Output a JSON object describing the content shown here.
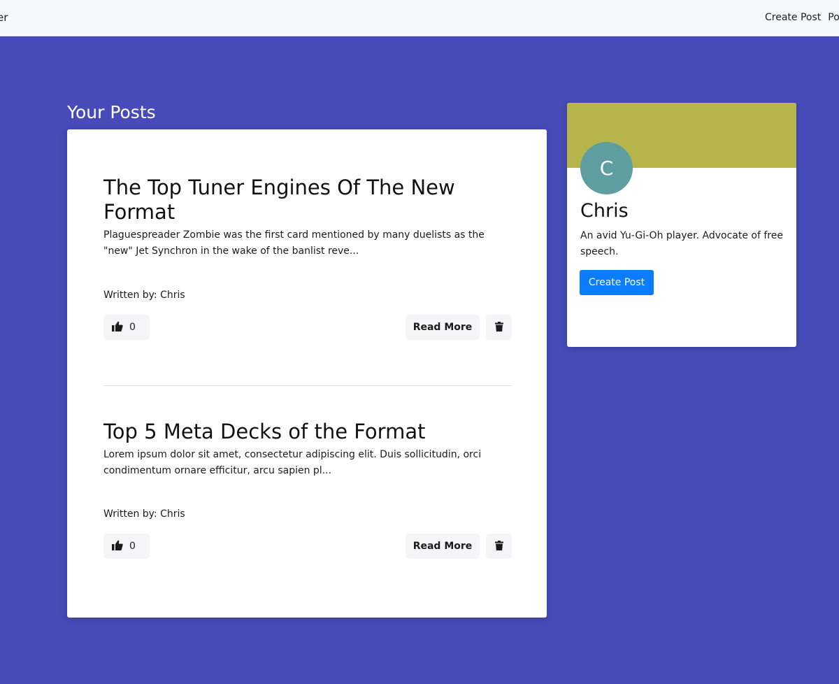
{
  "navbar": {
    "brand": "er",
    "links": [
      "Create Post",
      "Po"
    ]
  },
  "posts_section": {
    "heading": "Your Posts",
    "posts": [
      {
        "title": "The Top Tuner Engines Of The New Format",
        "excerpt": "Plaguespreader Zombie was the first card mentioned by many duelists as the \"new\" Jet Synchron in the wake of the banlist reve...",
        "author": "Written by: Chris",
        "likes": "0",
        "read_more_label": "Read More"
      },
      {
        "title": "Top 5 Meta Decks of the Format",
        "excerpt": "Lorem ipsum dolor sit amet, consectetur adipiscing elit. Duis sollicitudin, orci condimentum ornare efficitur, arcu sapien pl...",
        "author": "Written by: Chris",
        "likes": "0",
        "read_more_label": "Read More"
      }
    ]
  },
  "profile": {
    "initial": "C",
    "name": "Chris",
    "bio": "An avid Yu-Gi-Oh player. Advocate of free speech.",
    "create_post_label": "Create Post"
  },
  "icons": {
    "like": "thumbs-up-icon",
    "delete": "trash-icon"
  },
  "colors": {
    "background": "#474bb8",
    "banner": "#b5b54b",
    "avatar": "#5e9ea0",
    "primary_button": "#0a7cff"
  }
}
